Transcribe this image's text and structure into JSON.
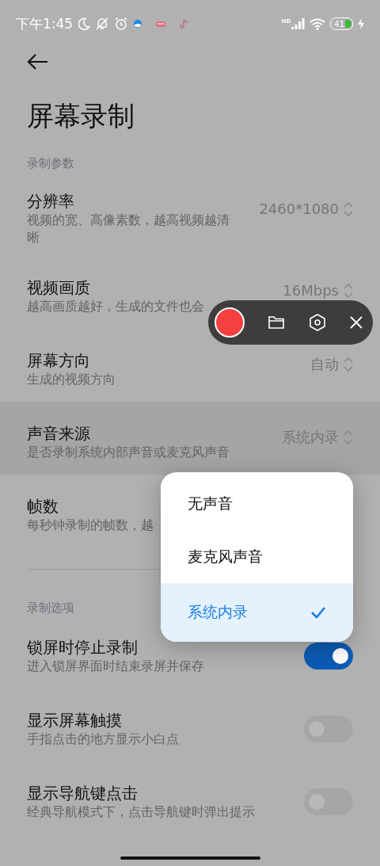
{
  "status_bar": {
    "time": "下午1:45",
    "network_badge": "HD",
    "battery": "41"
  },
  "header": {
    "title": "屏幕录制"
  },
  "sections": [
    {
      "label": "录制参数",
      "items": [
        {
          "kind": "select",
          "title": "分辨率",
          "subtitle": "视频的宽、高像素数，越高视频越清晰",
          "value": "2460*1080",
          "active": false
        },
        {
          "kind": "select",
          "title": "视频画质",
          "subtitle": "越高画质越好，生成的文件也会",
          "value": "16Mbps",
          "active": false
        },
        {
          "kind": "select",
          "title": "屏幕方向",
          "subtitle": "生成的视频方向",
          "value": "自动",
          "active": false
        },
        {
          "kind": "select",
          "title": "声音来源",
          "subtitle": "是否录制系统内部声音或麦克风声音",
          "value": "系统内录",
          "active": true
        },
        {
          "kind": "select",
          "title": "帧数",
          "subtitle": "每秒钟录制的帧数，越",
          "active": false
        }
      ]
    },
    {
      "label": "录制选项",
      "items": [
        {
          "kind": "toggle",
          "title": "锁屏时停止录制",
          "subtitle": "进入锁屏界面时结束录屏并保存",
          "on": true
        },
        {
          "kind": "toggle",
          "title": "显示屏幕触摸",
          "subtitle": "手指点击的地方显示小白点",
          "on": false
        },
        {
          "kind": "toggle",
          "title": "显示导航键点击",
          "subtitle": "经典导航模式下，点击导航键时弹出提示",
          "on": false
        }
      ]
    }
  ],
  "popup_menu": {
    "options": [
      {
        "label": "无声音",
        "selected": false
      },
      {
        "label": "麦克风声音",
        "selected": false
      },
      {
        "label": "系统内录",
        "selected": true
      }
    ]
  }
}
